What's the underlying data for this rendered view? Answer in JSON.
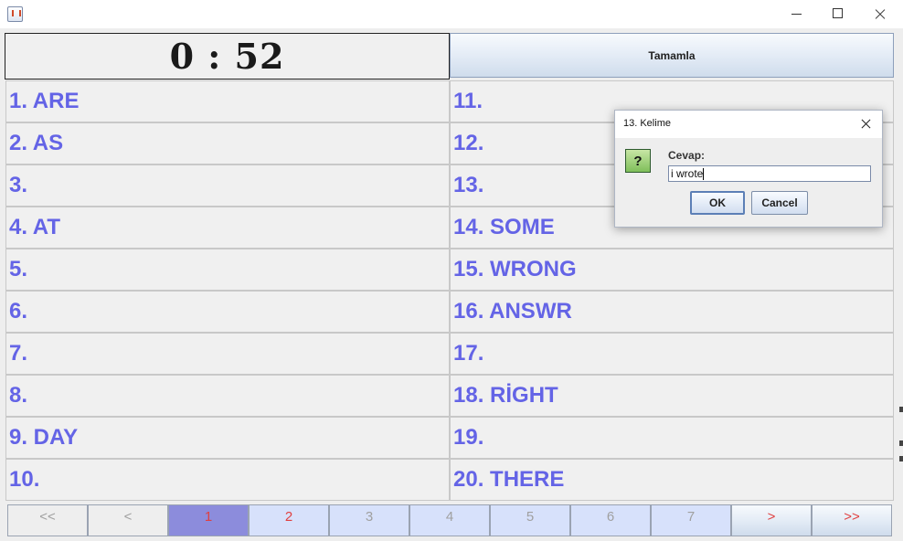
{
  "window": {
    "title": ""
  },
  "timer": {
    "text": "0 : 52"
  },
  "complete_button": {
    "label": "Tamamla"
  },
  "words_left": [
    "1. ARE",
    "2. AS",
    "3.",
    "4. AT",
    "5.",
    "6.",
    "7.",
    "8.",
    "9. DAY",
    "10."
  ],
  "words_right": [
    "11.",
    "12.",
    "13.",
    "14. SOME",
    "15. WRONG",
    "16. ANSWR",
    "17.",
    "18. RİGHT",
    "19.",
    "20. THERE"
  ],
  "pager": {
    "first": "<<",
    "prev": "<",
    "pages": [
      "1",
      "2",
      "3",
      "4",
      "5",
      "6",
      "7"
    ],
    "current": 1,
    "next": ">",
    "last": ">>"
  },
  "dialog": {
    "title": "13. Kelime",
    "icon": "question-icon",
    "icon_glyph": "?",
    "label": "Cevap:",
    "input_value": "i wrote",
    "ok_label": "OK",
    "cancel_label": "Cancel"
  },
  "colors": {
    "word_text": "#6464e6",
    "active_page_bg": "#8c8cdc",
    "page_bg": "#d7e1fb",
    "accent_red": "#e04040"
  }
}
